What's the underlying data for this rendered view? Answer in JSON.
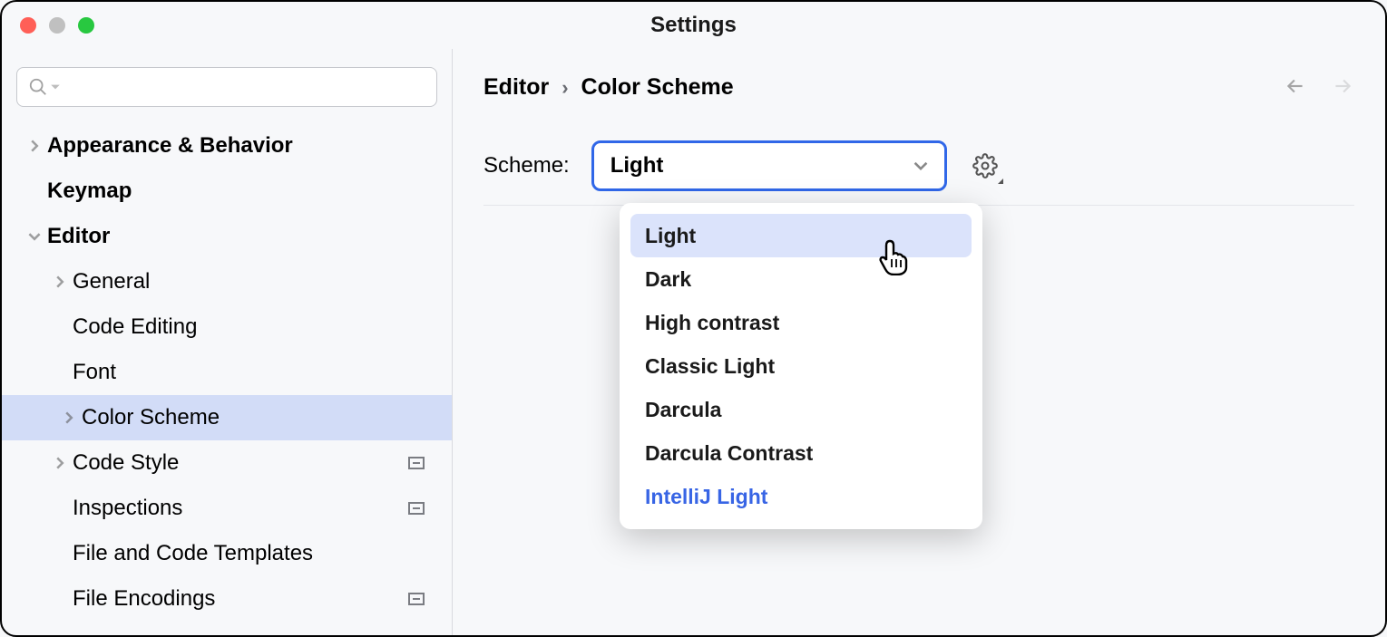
{
  "window": {
    "title": "Settings"
  },
  "sidebar": {
    "search_placeholder": "",
    "items": [
      {
        "label": "Appearance & Behavior",
        "expandable": true,
        "bold": true
      },
      {
        "label": "Keymap",
        "expandable": false,
        "bold": true
      },
      {
        "label": "Editor",
        "expandable": true,
        "expanded": true,
        "bold": true
      },
      {
        "label": "General",
        "expandable": true,
        "indent": 2
      },
      {
        "label": "Code Editing",
        "expandable": false,
        "indent": 2
      },
      {
        "label": "Font",
        "expandable": false,
        "indent": 2
      },
      {
        "label": "Color Scheme",
        "expandable": true,
        "indent": 2,
        "selected": true
      },
      {
        "label": "Code Style",
        "expandable": true,
        "indent": 2,
        "badge": true
      },
      {
        "label": "Inspections",
        "expandable": false,
        "indent": 2,
        "badge": true
      },
      {
        "label": "File and Code Templates",
        "expandable": false,
        "indent": 2
      },
      {
        "label": "File Encodings",
        "expandable": false,
        "indent": 2,
        "badge": true
      }
    ]
  },
  "breadcrumb": {
    "root": "Editor",
    "leaf": "Color Scheme"
  },
  "scheme": {
    "label": "Scheme:",
    "selected": "Light",
    "options": [
      {
        "label": "Light",
        "highlight": true
      },
      {
        "label": "Dark"
      },
      {
        "label": "High contrast"
      },
      {
        "label": "Classic Light"
      },
      {
        "label": "Darcula"
      },
      {
        "label": "Darcula Contrast"
      },
      {
        "label": "IntelliJ Light",
        "accent": true
      }
    ]
  }
}
